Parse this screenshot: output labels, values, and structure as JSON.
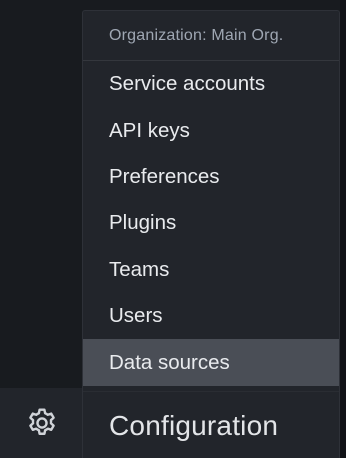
{
  "sidemenu": {
    "active_icon": "gear-icon"
  },
  "dropdown": {
    "header": "Organization: Main Org.",
    "items": [
      {
        "label": "Service accounts"
      },
      {
        "label": "API keys"
      },
      {
        "label": "Preferences"
      },
      {
        "label": "Plugins"
      },
      {
        "label": "Teams"
      },
      {
        "label": "Users"
      },
      {
        "label": "Data sources",
        "active": true
      }
    ],
    "footer_title": "Configuration"
  },
  "colors": {
    "background": "#181b1f",
    "menu_background": "#22252b",
    "active_item": "#4a4e56",
    "text": "#e9ebee",
    "muted_text": "#9fa7b3"
  }
}
